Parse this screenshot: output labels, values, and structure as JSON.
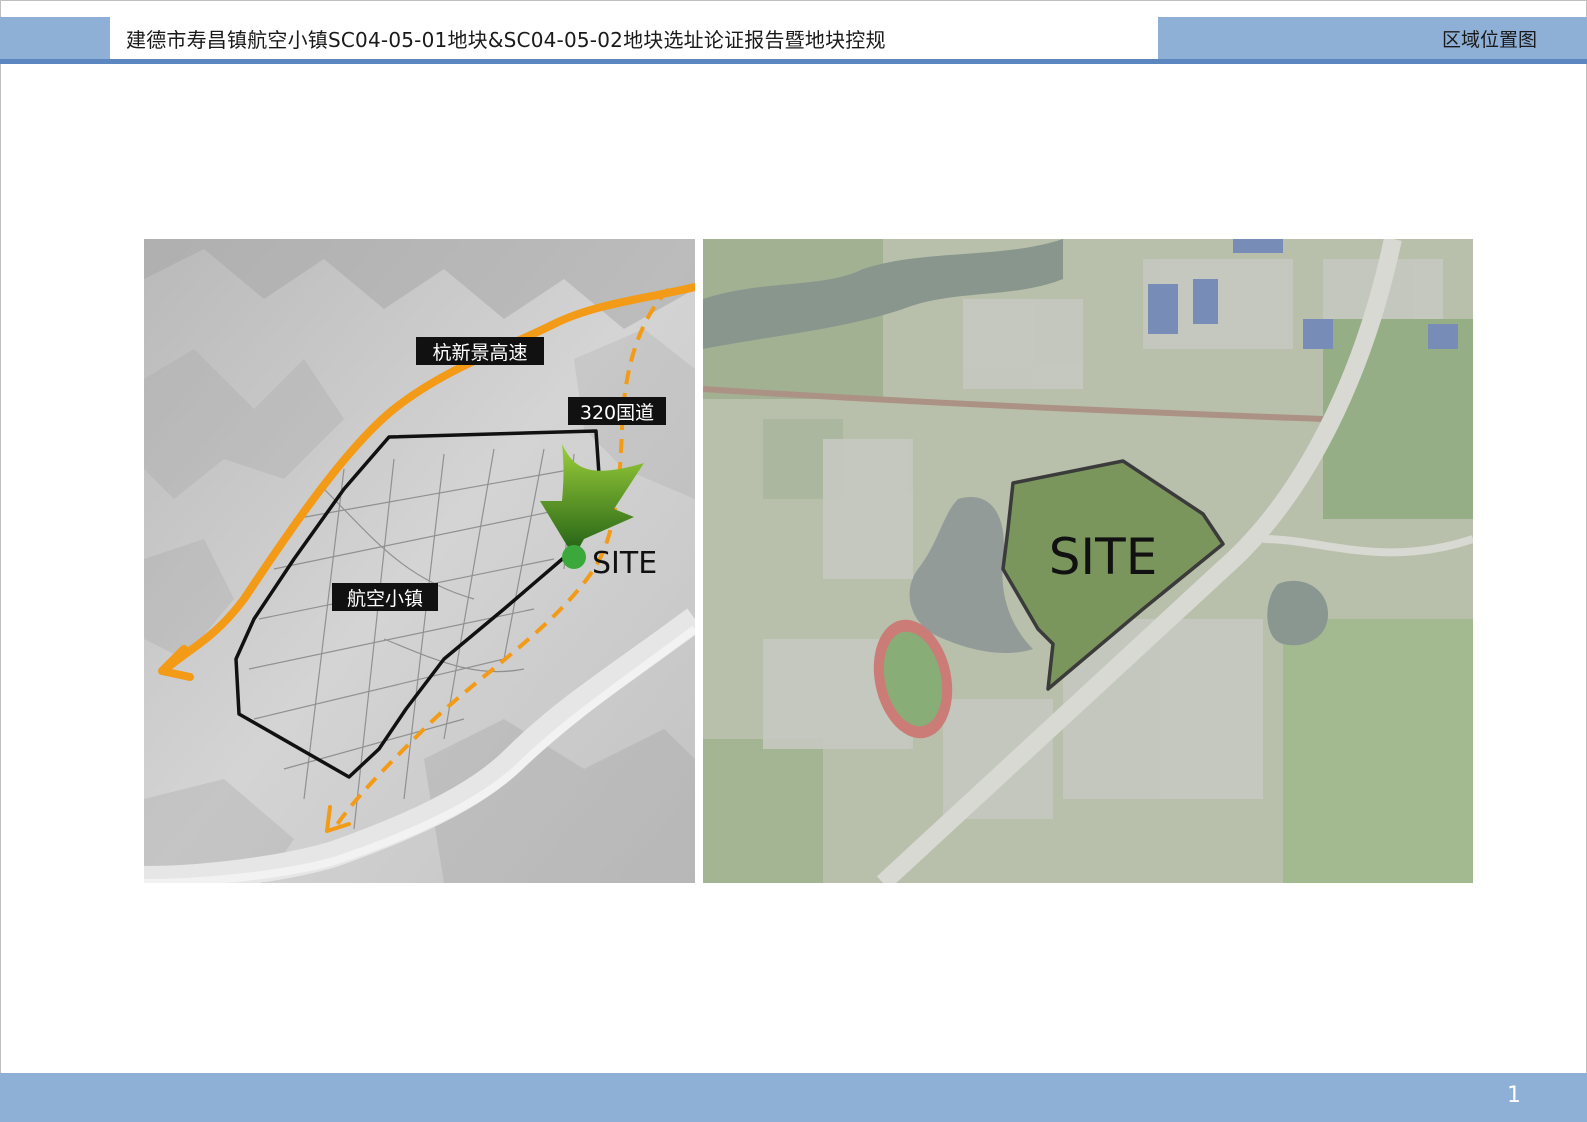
{
  "header": {
    "title": "建德市寿昌镇航空小镇SC04-05-01地块&SC04-05-02地块选址论证报告暨地块控规",
    "section": "区域位置图"
  },
  "footer": {
    "page_number": "1"
  },
  "regional_map": {
    "labels": {
      "expressway": "杭新景高速",
      "national_road": "320国道",
      "town": "航空小镇",
      "site": "SITE"
    },
    "colors": {
      "expressway": "#f39a17",
      "national_road": "#f39a17",
      "site_marker": "#3aa83a",
      "arrow": "#2e7d1e",
      "boundary": "#111111"
    },
    "icons": [
      "site-dot-icon",
      "site-arrow-icon",
      "direction-arrow-icon"
    ]
  },
  "site_map": {
    "labels": {
      "site": "SITE"
    },
    "colors": {
      "site_fill": "#5f7f3a",
      "boundary": "#111111"
    }
  }
}
